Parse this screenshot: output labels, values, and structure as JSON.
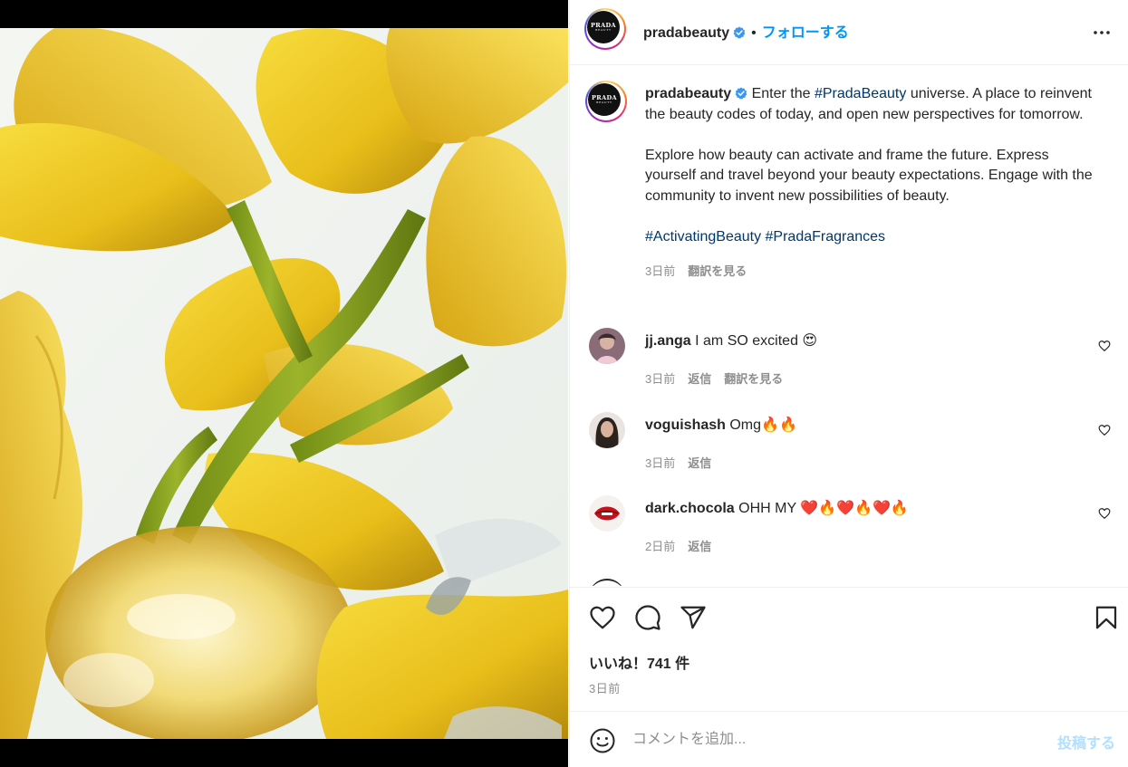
{
  "post": {
    "author": "pradabeauty",
    "avatar_logo_text": "PRADA",
    "avatar_logo_sub": "BEAUTY",
    "separator": "•",
    "follow_label": "フォローする",
    "more_icon": "more-horizontal-icon"
  },
  "caption": {
    "author": "pradabeauty",
    "p1_pre": "Enter the ",
    "p1_tag": "#PradaBeauty",
    "p1_post": " universe. A place to reinvent the beauty codes of today, and open new perspectives for tomorrow.",
    "p2": "Explore how beauty can activate and frame the future. Express yourself and travel beyond your beauty expectations. Engage with the community to invent new possibilities of beauty.",
    "tag1": "#ActivatingBeauty",
    "tag2": "#PradaFragrances",
    "time": "3日前",
    "translate": "翻訳を見る"
  },
  "comments": [
    {
      "user": "jj.anga",
      "text": "I am SO excited 😍",
      "time": "3日前",
      "reply": "返信",
      "translate": "翻訳を見る"
    },
    {
      "user": "voguishash",
      "text": "Omg🔥🔥",
      "time": "3日前",
      "reply": "返信"
    },
    {
      "user": "dark.chocola",
      "text": "OHH MY ❤️🔥❤️🔥❤️🔥",
      "time": "2日前",
      "reply": "返信"
    }
  ],
  "actions": {
    "likes_label": "いいね！741 件",
    "date": "3日前"
  },
  "composer": {
    "placeholder": "コメントを追加...",
    "post_label": "投稿する"
  },
  "colors": {
    "accent": "#0095f6",
    "hashtag": "#00376b",
    "muted": "#8e8e8e",
    "post_disabled": "#b2dffc"
  }
}
